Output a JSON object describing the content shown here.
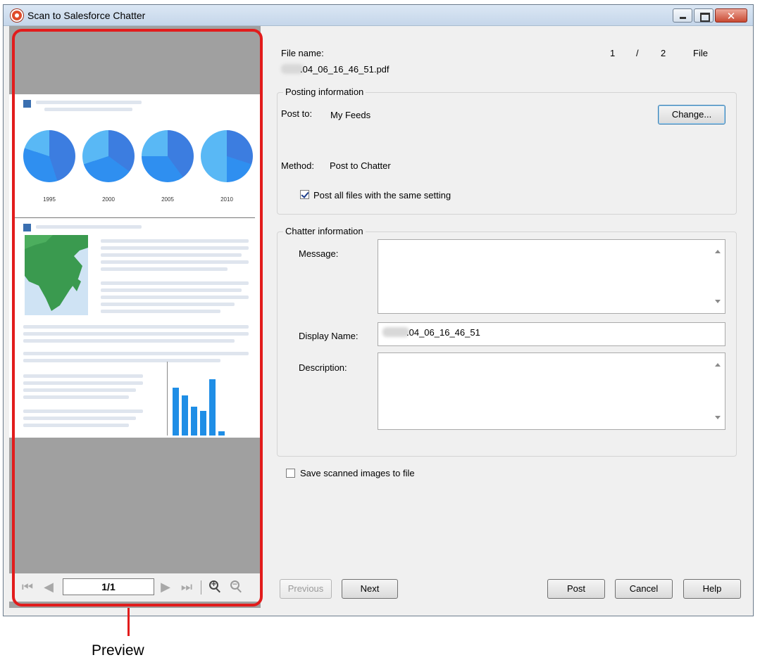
{
  "window": {
    "title": "Scan to Salesforce Chatter"
  },
  "preview": {
    "page_indicator": "1/1",
    "pie_years": [
      "1995",
      "2000",
      "2005",
      "2010"
    ],
    "callout_label": "Preview"
  },
  "file": {
    "label": "File name:",
    "name_suffix": ".04_06_16_46_51.pdf",
    "index": "1",
    "separator": "/",
    "total": "2",
    "unit": "File"
  },
  "posting": {
    "group_title": "Posting information",
    "post_to_label": "Post to:",
    "post_to_value": "My Feeds",
    "change_button": "Change...",
    "method_label": "Method:",
    "method_value": "Post to Chatter",
    "same_setting_label": "Post all files with the same setting",
    "same_setting_checked": true
  },
  "chatter": {
    "group_title": "Chatter information",
    "message_label": "Message:",
    "message_value": "",
    "display_name_label": "Display Name:",
    "display_name_value": ".04_06_16_46_51",
    "description_label": "Description:",
    "description_value": ""
  },
  "save_scanned_label": "Save scanned images to file",
  "save_scanned_checked": false,
  "buttons": {
    "previous": "Previous",
    "next": "Next",
    "post": "Post",
    "cancel": "Cancel",
    "help": "Help"
  }
}
